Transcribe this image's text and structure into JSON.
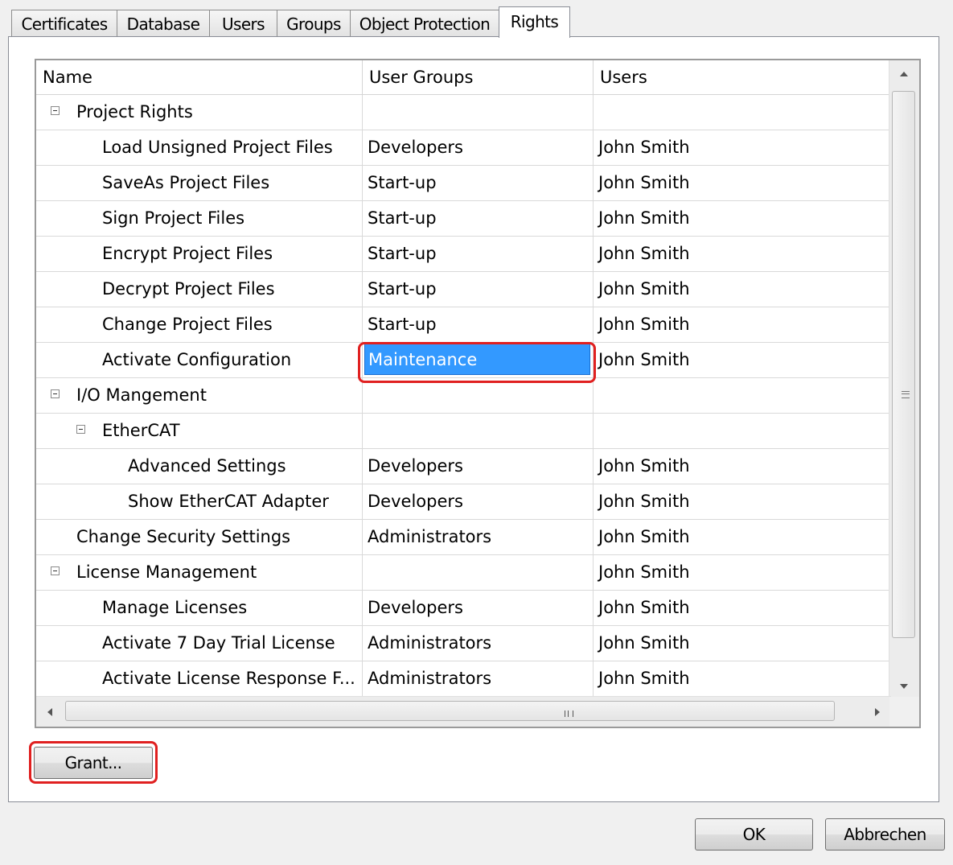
{
  "tabs": [
    {
      "label": "Certificates",
      "active": false
    },
    {
      "label": "Database",
      "active": false
    },
    {
      "label": "Users",
      "active": false
    },
    {
      "label": "Groups",
      "active": false
    },
    {
      "label": "Object Protection",
      "active": false
    },
    {
      "label": "Rights",
      "active": true
    }
  ],
  "grid": {
    "columns": [
      "Name",
      "User Groups",
      "Users"
    ],
    "rows": [
      {
        "name": "Project Rights",
        "groups": "",
        "users": "",
        "level": 0,
        "expander": true
      },
      {
        "name": "Load Unsigned Project Files",
        "groups": "Developers",
        "users": "John Smith",
        "level": 1
      },
      {
        "name": "SaveAs Project Files",
        "groups": "Start-up",
        "users": "John Smith",
        "level": 1
      },
      {
        "name": "Sign Project Files",
        "groups": "Start-up",
        "users": "John Smith",
        "level": 1
      },
      {
        "name": "Encrypt Project Files",
        "groups": "Start-up",
        "users": "John Smith",
        "level": 1
      },
      {
        "name": "Decrypt Project Files",
        "groups": "Start-up",
        "users": "John Smith",
        "level": 1
      },
      {
        "name": "Change Project Files",
        "groups": "Start-up",
        "users": "John Smith",
        "level": 1
      },
      {
        "name": "Activate Configuration",
        "groups": "Maintenance",
        "users": "John Smith",
        "level": 1,
        "selected": true
      },
      {
        "name": "I/O Mangement",
        "groups": "",
        "users": "",
        "level": 0,
        "expander": true
      },
      {
        "name": "EtherCAT",
        "groups": "",
        "users": "",
        "level": 1,
        "expander": true
      },
      {
        "name": "Advanced Settings",
        "groups": "Developers",
        "users": "John Smith",
        "level": 2
      },
      {
        "name": "Show EtherCAT Adapter",
        "groups": "Developers",
        "users": "John Smith",
        "level": 2
      },
      {
        "name": "Change Security Settings",
        "groups": "Administrators",
        "users": "John Smith",
        "level": 0
      },
      {
        "name": "License Management",
        "groups": "",
        "users": "John Smith",
        "level": 0,
        "expander": true
      },
      {
        "name": "Manage Licenses",
        "groups": "Developers",
        "users": "John Smith",
        "level": 1
      },
      {
        "name": "Activate 7 Day Trial License",
        "groups": "Administrators",
        "users": "John Smith",
        "level": 1
      },
      {
        "name": "Activate License Response F...",
        "groups": "Administrators",
        "users": "John Smith",
        "level": 1
      }
    ]
  },
  "buttons": {
    "grant": "Grant...",
    "ok": "OK",
    "cancel": "Abbrechen"
  },
  "colors": {
    "selection": "#3399ff",
    "highlight": "#e02020"
  }
}
